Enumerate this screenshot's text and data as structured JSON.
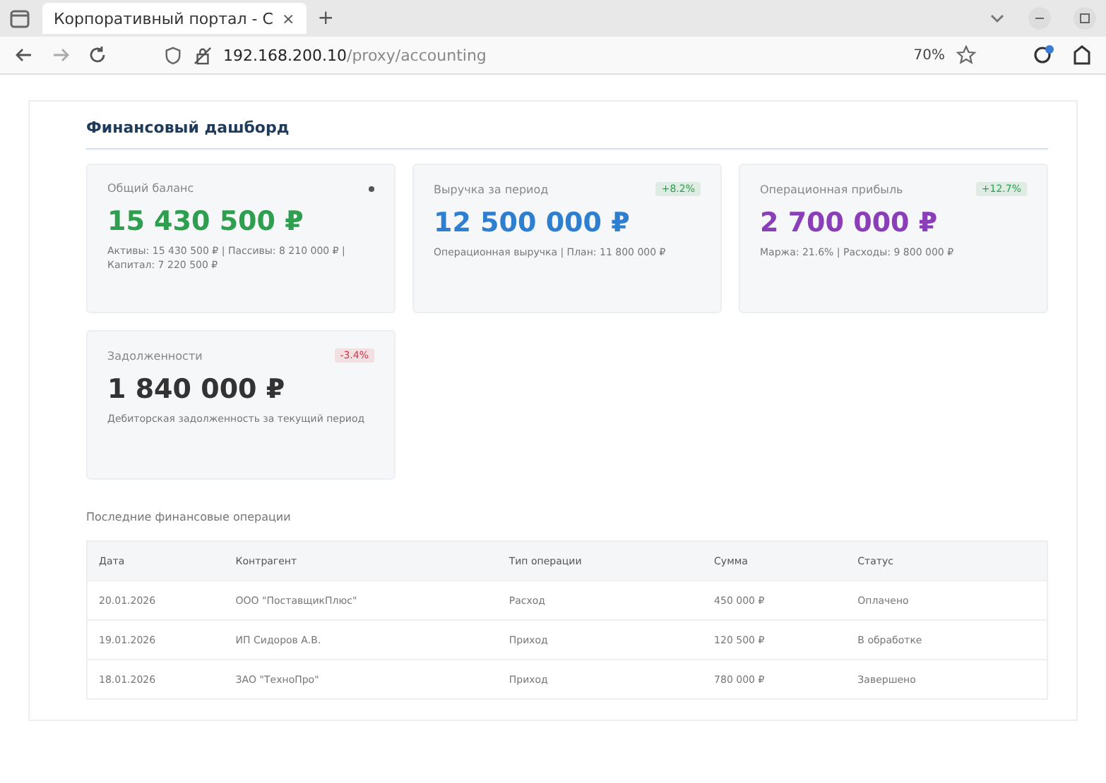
{
  "browser": {
    "tab_title": "Корпоративный портал - С",
    "tab_close": "×",
    "new_tab": "+",
    "url_host": "192.168.200.10",
    "url_path": "/proxy/accounting",
    "zoom": "70%"
  },
  "page": {
    "title": "Финансовый дашборд",
    "cards": [
      {
        "label": "Общий баланс",
        "badge": {
          "kind": "dot",
          "color": "#555555"
        },
        "value": "15 430 500 ₽",
        "color": "#2e9e4f",
        "note": "Активы: 15 430 500 ₽ | Пассивы: 8 210 000 ₽ | Капитал: 7 220 500 ₽"
      },
      {
        "label": "Выручка за период",
        "badge": {
          "kind": "pill",
          "text": "+8.2%",
          "color": "#2e9e4f"
        },
        "value": "12 500 000 ₽",
        "color": "#2f7fd0",
        "note": "Операционная выручка | План: 11 800 000 ₽"
      },
      {
        "label": "Операционная прибыль",
        "badge": {
          "kind": "pill",
          "text": "+12.7%",
          "color": "#2e9e4f"
        },
        "value": "2 700 000 ₽",
        "color": "#8a3fb8",
        "note": "Маржа: 21.6% | Расходы: 9 800 000 ₽"
      },
      {
        "label": "Задолженности",
        "badge": {
          "kind": "pill",
          "text": "-3.4%",
          "color": "#d9364a"
        },
        "value": "1 840 000 ₽",
        "color": "#333333",
        "note": "Дебиторская задолженность за текущий период"
      }
    ],
    "section_title": "Последние финансовые операции",
    "table": {
      "columns": [
        "Дата",
        "Контрагент",
        "Тип операции",
        "Сумма",
        "Статус"
      ],
      "rows": [
        [
          "20.01.2026",
          "ООО \"ПоставщикПлюс\"",
          "Расход",
          "450 000 ₽",
          "Оплачено"
        ],
        [
          "19.01.2026",
          "ИП Сидоров А.В.",
          "Приход",
          "120 500 ₽",
          "В обработке"
        ],
        [
          "18.01.2026",
          "ЗАО \"ТехноПро\"",
          "Приход",
          "780 000 ₽",
          "Завершено"
        ]
      ]
    }
  }
}
